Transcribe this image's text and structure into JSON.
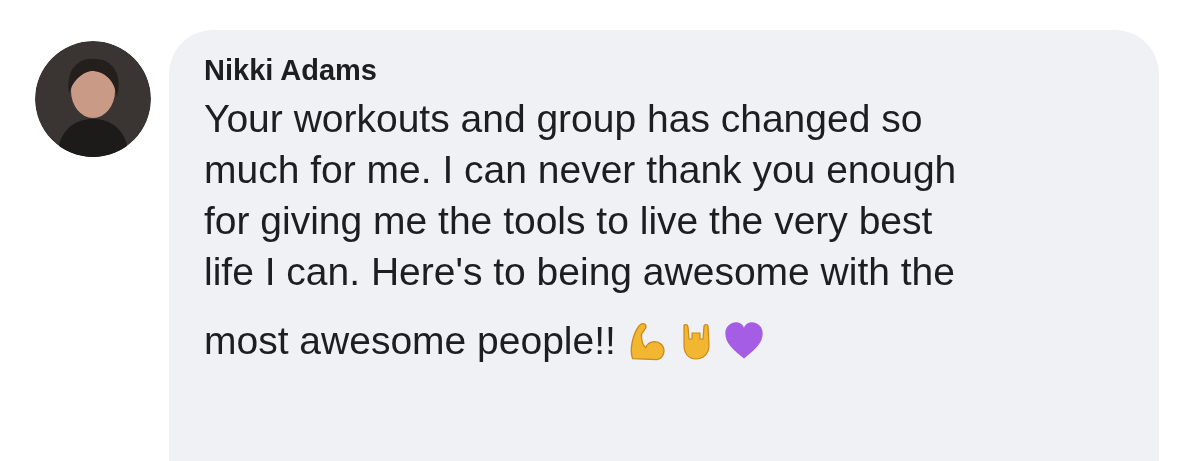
{
  "comment": {
    "author": "Nikki Adams",
    "text_lines": [
      "Your workouts and group has changed so",
      "much for me. I can never thank you enough",
      "for giving me the tools to live the very best",
      "life I can. Here's to being awesome with the",
      "most awesome people!!"
    ]
  }
}
